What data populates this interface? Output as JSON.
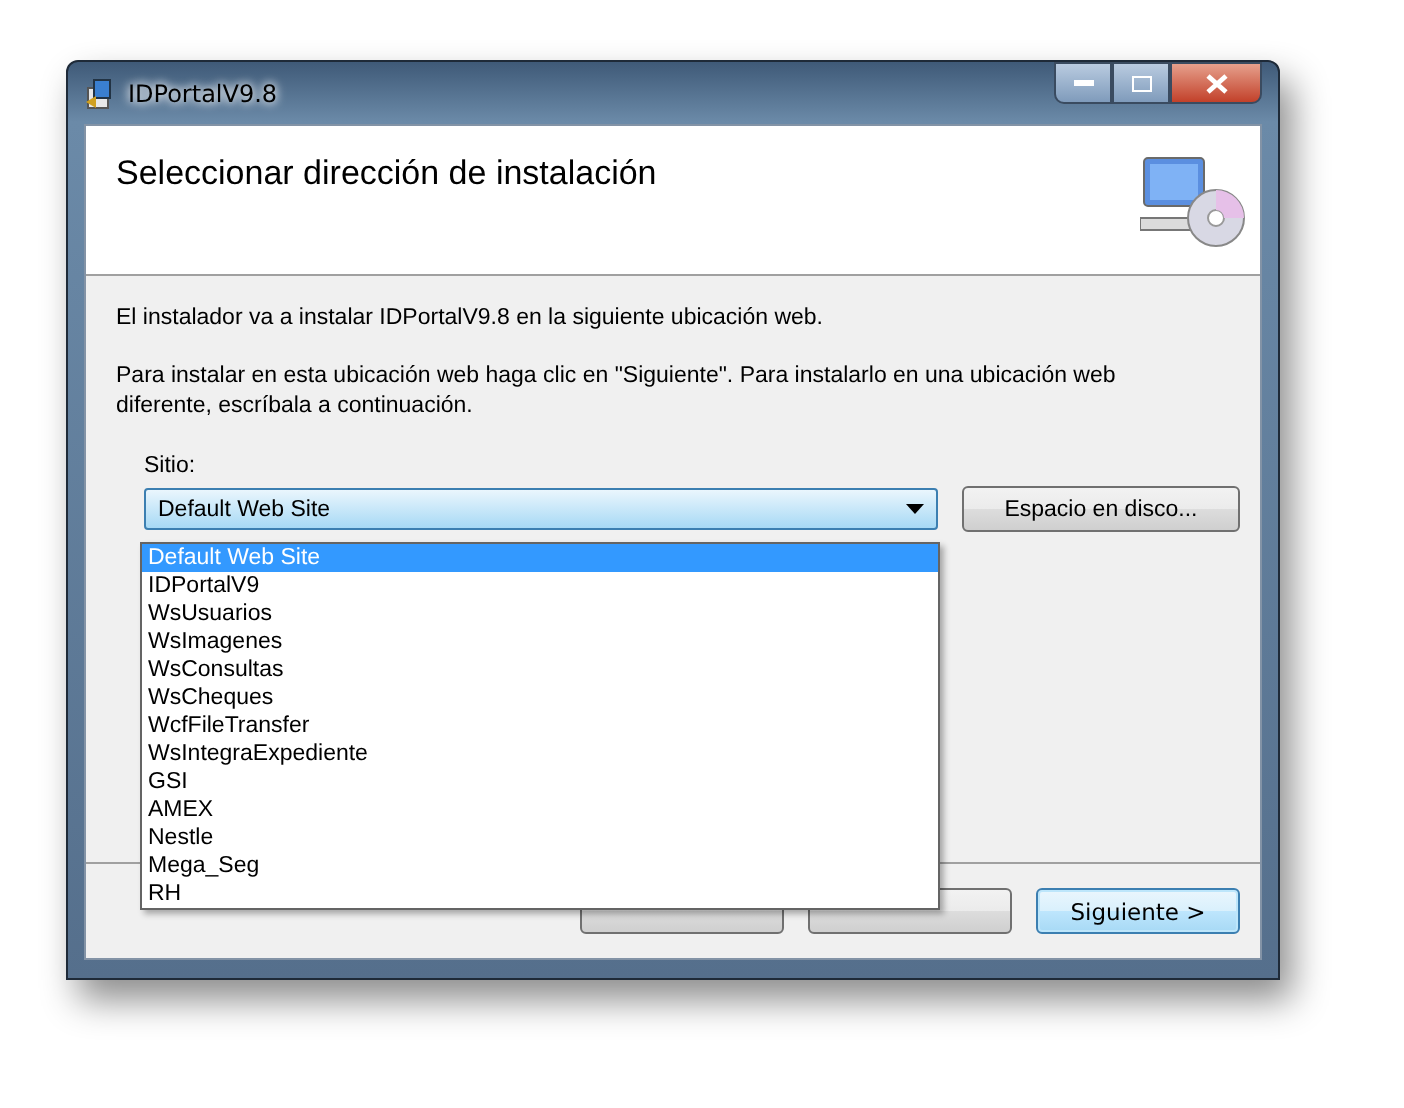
{
  "window": {
    "title": "IDPortalV9.8"
  },
  "header": {
    "title": "Seleccionar dirección de instalación"
  },
  "paragraphs": [
    "El instalador va a instalar IDPortalV9.8 en la siguiente ubicación web.",
    "Para instalar en esta ubicación web haga clic en \"Siguiente\". Para instalarlo en una ubicación web diferente, escríbala a continuación."
  ],
  "site": {
    "label": "Sitio:",
    "value": "Default Web Site",
    "expanded": true,
    "options": [
      {
        "label": "Default Web Site",
        "selected": true
      },
      {
        "label": "IDPortalV9",
        "selected": false
      },
      {
        "label": "WsUsuarios",
        "selected": false
      },
      {
        "label": "WsImagenes",
        "selected": false
      },
      {
        "label": "WsConsultas",
        "selected": false
      },
      {
        "label": "WsCheques",
        "selected": false
      },
      {
        "label": "WcfFileTransfer",
        "selected": false
      },
      {
        "label": "WsIntegraExpediente",
        "selected": false
      },
      {
        "label": "GSI",
        "selected": false
      },
      {
        "label": "AMEX",
        "selected": false
      },
      {
        "label": "Nestle",
        "selected": false
      },
      {
        "label": "Mega_Seg",
        "selected": false
      },
      {
        "label": "RH",
        "selected": false
      }
    ]
  },
  "disk_button": "Espacio en disco...",
  "buttons": [
    {
      "default": false
    },
    {
      "default": false
    },
    {
      "label": "Siguiente >",
      "default": true
    }
  ]
}
